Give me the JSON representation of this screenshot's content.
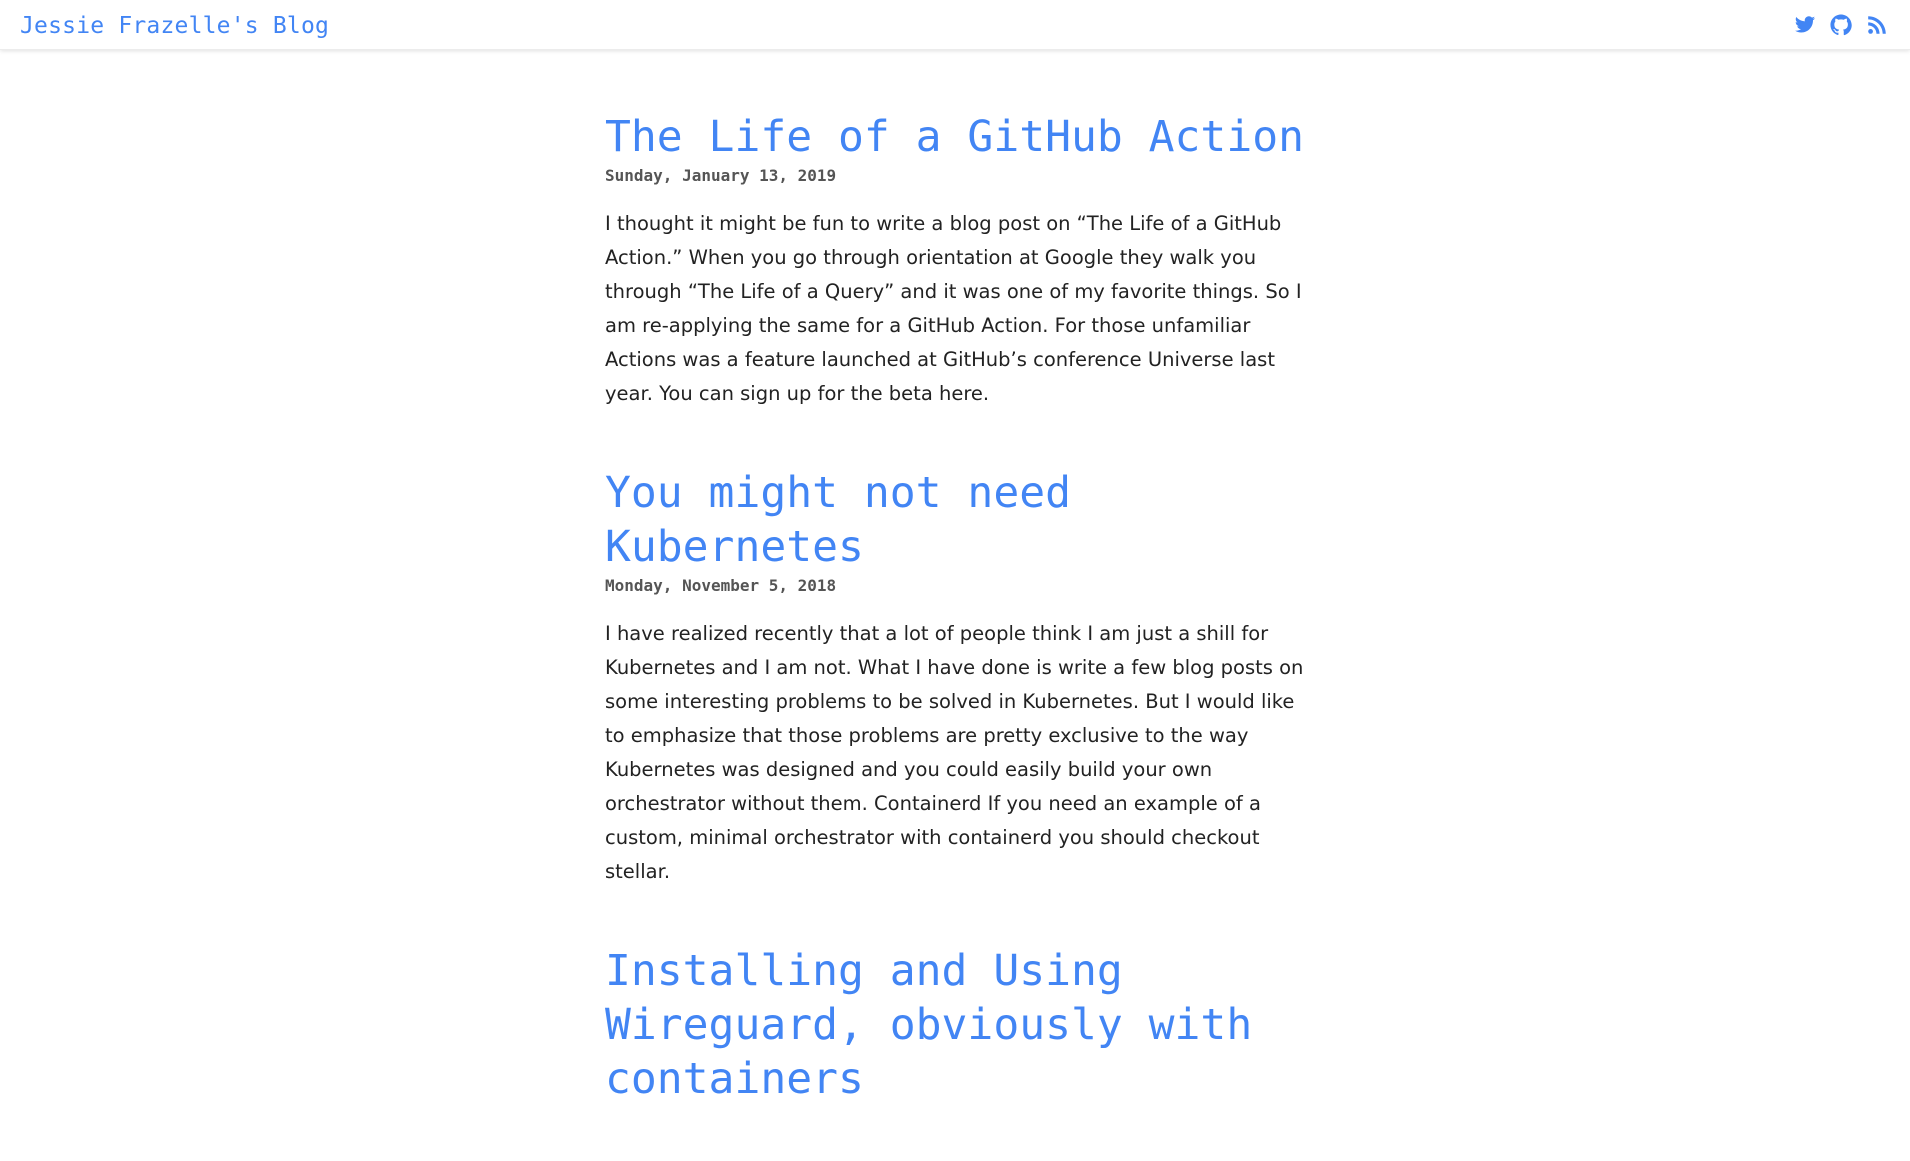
{
  "header": {
    "site_title": "Jessie Frazelle's Blog",
    "icons": [
      "twitter-icon",
      "github-icon",
      "rss-icon"
    ]
  },
  "colors": {
    "accent": "#4285f4",
    "text": "#222222",
    "date": "#555555"
  },
  "posts": [
    {
      "title": "The Life of a GitHub Action",
      "date": "Sunday, January 13, 2019",
      "excerpt": "I thought it might be fun to write a blog post on “The Life of a GitHub Action.” When you go through orientation at Google they walk you through “The Life of a Query” and it was one of my favorite things. So I am re-applying the same for a GitHub Action. For those unfamiliar Actions was a feature launched at GitHub’s conference Universe last year. You can sign up for the beta here."
    },
    {
      "title": "You might not need Kubernetes",
      "date": "Monday, November 5, 2018",
      "excerpt": "I have realized recently that a lot of people think I am just a shill for Kubernetes and I am not. What I have done is write a few blog posts on some interesting problems to be solved in Kubernetes. But I would like to emphasize that those problems are pretty exclusive to the way Kubernetes was designed and you could easily build your own orchestrator without them. Containerd If you need an example of a custom, minimal orchestrator with containerd you should checkout stellar."
    },
    {
      "title": "Installing and Using Wireguard, obviously with containers",
      "date": "",
      "excerpt": ""
    }
  ]
}
